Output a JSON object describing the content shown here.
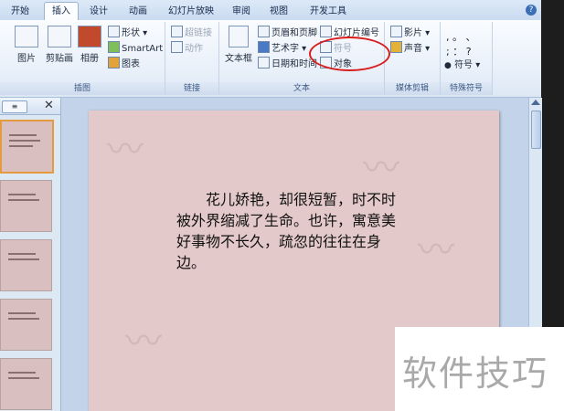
{
  "tabs": [
    {
      "label": "开始"
    },
    {
      "label": "插入"
    },
    {
      "label": "设计"
    },
    {
      "label": "动画"
    },
    {
      "label": "幻灯片放映"
    },
    {
      "label": "审阅"
    },
    {
      "label": "视图"
    },
    {
      "label": "开发工具"
    }
  ],
  "active_tab": "插入",
  "help_icon": "?",
  "groups": {
    "illustrations": {
      "label": "插图",
      "picture": "图片",
      "clipart": "剪贴画",
      "album": "相册",
      "shapes": "形状",
      "smartart": "SmartArt",
      "chart": "图表"
    },
    "links": {
      "label": "链接",
      "hyperlink": "超链接",
      "action": "动作"
    },
    "text": {
      "label": "文本",
      "textbox": "文本框",
      "header_footer": "页眉和页脚",
      "wordart": "艺术字",
      "datetime": "日期和时间",
      "slide_number": "幻灯片编号",
      "symbol": "符号",
      "object": "对象"
    },
    "media": {
      "label": "媒体剪辑",
      "movie": "影片",
      "sound": "声音"
    },
    "special": {
      "label": "特殊符号",
      "row1": ",  。 、",
      "row2": ";  ：  ?",
      "symbol": "符号"
    }
  },
  "slide": {
    "text": "花儿娇艳，却很短暂，时不时被外界缩减了生命。也许，寓意美好事物不长久，疏忽的往往在身边。"
  },
  "watermark": "软件技巧",
  "colors": {
    "annotation_circle": "#d81e1e",
    "slide_bg": "#e3c9c9",
    "selected_thumb_border": "#e49a3d"
  }
}
